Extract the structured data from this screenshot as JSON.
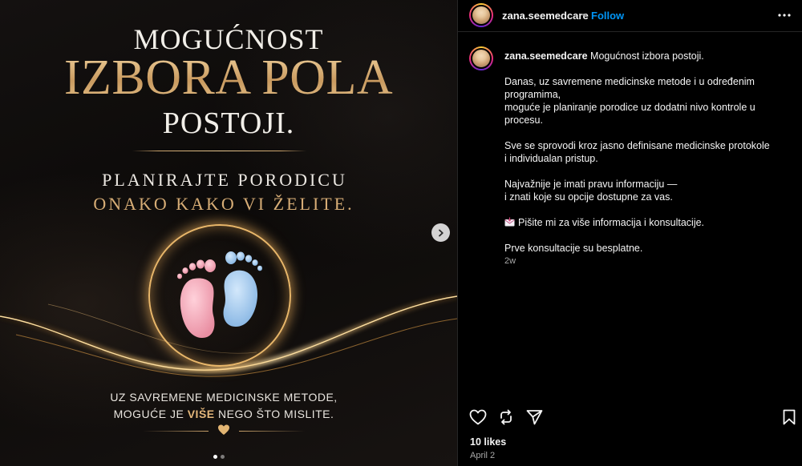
{
  "post_image": {
    "line1": "MOGUĆNOST",
    "line2": "IZBORA POLA",
    "line3": "POSTOJI.",
    "line4": "PLANIRAJTE PORODICU",
    "line5": "ONAKO KAKO VI ŽELITE.",
    "line6": "UZ SAVREMENE MEDICINSKE METODE,",
    "line7_a": "MOGUĆE JE ",
    "line7_b": "VIŠE",
    "line7_c": " NEGO ŠTO MISLITE.",
    "carousel": {
      "current": 1,
      "total": 2
    }
  },
  "header": {
    "username": "zana.seemedcare",
    "separator": "•",
    "follow_label": "Follow"
  },
  "caption": {
    "username": "zana.seemedcare",
    "first_line": "Mogućnost izbora postoji.",
    "paragraphs": [
      [
        "Danas, uz savremene medicinske metode i u određenim",
        "programima,",
        "moguće je planiranje porodice uz dodatni nivo kontrole u",
        "procesu."
      ],
      [
        "Sve se sprovodi kroz jasno definisane medicinske protokole",
        "i individualan pristup."
      ],
      [
        "Najvažnije je imati pravu informaciju —",
        "i znati koje su opcije dostupne za vas."
      ]
    ],
    "cta": "Pišite mi za više informacija i konsultacije.",
    "closing": "Prve konsultacije su besplatne.",
    "time_ago": "2w"
  },
  "footer": {
    "likes": "10 likes",
    "date": "April 2"
  },
  "colors": {
    "gold": "#d9b07a",
    "follow_blue": "#0095f6",
    "pink_foot": "#f2a7b6",
    "blue_foot": "#9ec7ee"
  },
  "icons": [
    "chevron-right-icon",
    "heart-icon",
    "repost-icon",
    "send-icon",
    "bookmark-icon",
    "more-options-icon",
    "envelope-icon"
  ]
}
